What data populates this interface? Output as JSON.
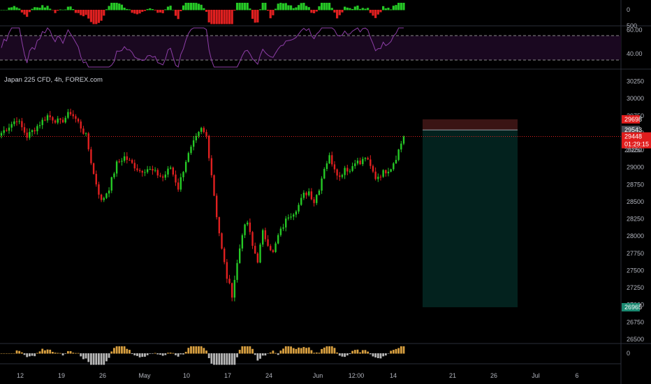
{
  "symbol_title": "Japan 225 CFD, 4h, FOREX.com",
  "colors": {
    "up": "#26c926",
    "down": "#e02020",
    "rsi_line": "#8e3fa8",
    "rsi_band": "#1a0820",
    "stop_zone": "#3a1414",
    "target_zone": "#03221e",
    "price_tag": "#e01d1d",
    "target_tag": "#1b8a72",
    "entry_tag": "#4a4d55"
  },
  "panes": {
    "top_histogram": {
      "zero_label": "0"
    },
    "rsi": {
      "upper_label": "60.00",
      "overlap_label": "500",
      "lower_label": "40.00",
      "upper": 60,
      "lower": 40
    },
    "bottom_oscillator": {
      "zero_label": "0"
    }
  },
  "price_tags": {
    "stop": "29698",
    "entry": "29543",
    "last": "29448",
    "countdown": "01:29:15",
    "partial": "29250",
    "target": "26965"
  },
  "chart_data": {
    "type": "candlestick",
    "title": "Japan 225 CFD, 4h, FOREX.com",
    "y_ticks": [
      "30250",
      "30000",
      "29750",
      "29500",
      "29250",
      "29000",
      "28750",
      "28500",
      "28250",
      "28000",
      "27750",
      "27500",
      "27250",
      "27000",
      "26750",
      "26500"
    ],
    "x_ticks": [
      "12",
      "19",
      "26",
      "May",
      "10",
      "17",
      "24",
      "Jun",
      "12:00",
      "14",
      "21",
      "26",
      "Jul",
      "6"
    ],
    "ylim": [
      26400,
      30350
    ],
    "path_anchors": [
      [
        0,
        29500
      ],
      [
        6,
        29700
      ],
      [
        10,
        29450
      ],
      [
        14,
        29600
      ],
      [
        18,
        29750
      ],
      [
        23,
        29650
      ],
      [
        27,
        29800
      ],
      [
        30,
        29650
      ],
      [
        33,
        29450
      ],
      [
        36,
        28900
      ],
      [
        39,
        28500
      ],
      [
        42,
        28700
      ],
      [
        45,
        29050
      ],
      [
        48,
        29150
      ],
      [
        51,
        29050
      ],
      [
        54,
        28950
      ],
      [
        57,
        28980
      ],
      [
        60,
        28920
      ],
      [
        63,
        28850
      ],
      [
        66,
        29000
      ],
      [
        69,
        28700
      ],
      [
        72,
        29100
      ],
      [
        75,
        29350
      ],
      [
        78,
        29550
      ],
      [
        80,
        29450
      ],
      [
        82,
        28900
      ],
      [
        84,
        28300
      ],
      [
        86,
        27800
      ],
      [
        88,
        27400
      ],
      [
        90,
        27150
      ],
      [
        92,
        27600
      ],
      [
        94,
        28050
      ],
      [
        96,
        28200
      ],
      [
        98,
        27850
      ],
      [
        100,
        27650
      ],
      [
        102,
        28050
      ],
      [
        104,
        27900
      ],
      [
        106,
        27750
      ],
      [
        108,
        28000
      ],
      [
        110,
        28150
      ],
      [
        112,
        28300
      ],
      [
        114,
        28350
      ],
      [
        116,
        28450
      ],
      [
        118,
        28600
      ],
      [
        120,
        28650
      ],
      [
        122,
        28500
      ],
      [
        124,
        28700
      ],
      [
        126,
        29000
      ],
      [
        128,
        29150
      ],
      [
        130,
        29000
      ],
      [
        132,
        28850
      ],
      [
        134,
        29000
      ],
      [
        136,
        28950
      ],
      [
        138,
        29100
      ],
      [
        140,
        29050
      ],
      [
        142,
        29150
      ],
      [
        144,
        29000
      ],
      [
        146,
        28850
      ],
      [
        148,
        28900
      ],
      [
        150,
        28950
      ],
      [
        152,
        29000
      ],
      [
        154,
        29150
      ],
      [
        156,
        29350
      ],
      [
        157,
        29448
      ]
    ],
    "candles_total": 158,
    "last_price": 29448,
    "position": {
      "type": "short",
      "entry": 29543,
      "stop": 29698,
      "target": 26965
    }
  }
}
